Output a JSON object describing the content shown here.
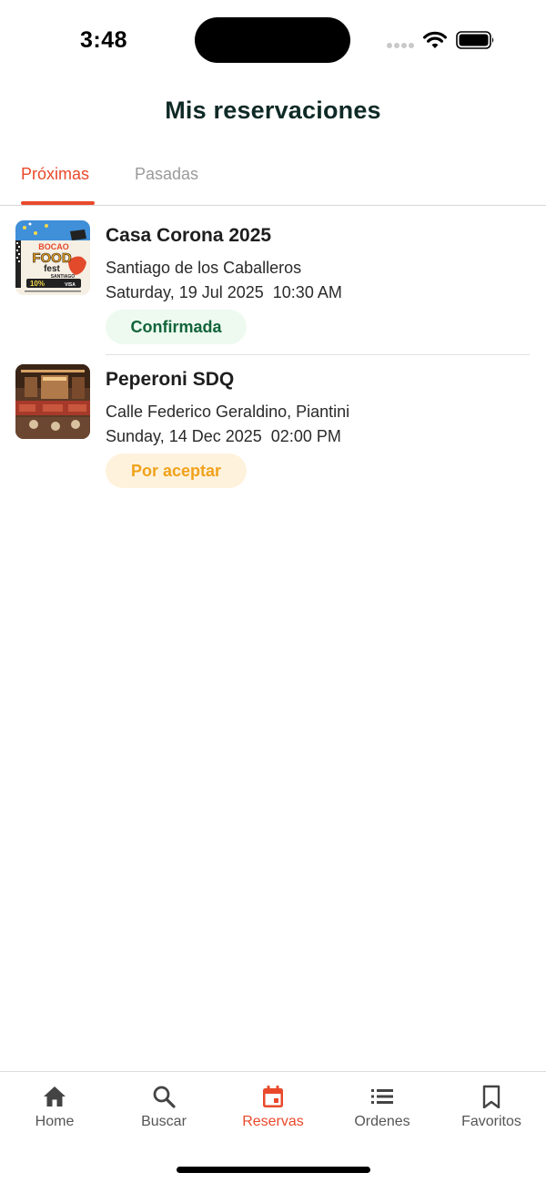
{
  "status_bar": {
    "time": "3:48"
  },
  "header": {
    "title": "Mis reservaciones"
  },
  "tabs": [
    {
      "label": "Próximas",
      "active": true
    },
    {
      "label": "Pasadas",
      "active": false
    }
  ],
  "reservations": [
    {
      "title": "Casa Corona 2025",
      "address": "Santiago de los Caballeros",
      "date": "Saturday, 19 Jul 2025  10:30 AM",
      "status": "Confirmada",
      "image_icon": "bocao-food-fest-poster",
      "poster_text": [
        "BOCAO",
        "FOOD",
        "fest",
        "SANTIAGO",
        "10%",
        "VISA"
      ]
    },
    {
      "title": "Peperoni SDQ",
      "address": "Calle Federico Geraldino, Piantini",
      "date": "Sunday, 14 Dec 2025  02:00 PM",
      "status": "Por aceptar",
      "image_icon": "restaurant-interior-photo"
    }
  ],
  "bottom_nav": [
    {
      "label": "Home",
      "icon": "home-icon",
      "active": false
    },
    {
      "label": "Buscar",
      "icon": "search-icon",
      "active": false
    },
    {
      "label": "Reservas",
      "icon": "calendar-icon",
      "active": true
    },
    {
      "label": "Ordenes",
      "icon": "list-icon",
      "active": false
    },
    {
      "label": "Favoritos",
      "icon": "bookmark-icon",
      "active": false
    }
  ],
  "colors": {
    "accent": "#e9492b",
    "title": "#0f2a26",
    "confirmed_text": "#12643a",
    "confirmed_bg": "#eefaf0",
    "pending_text": "#f0a21b",
    "pending_bg": "#fff2dd"
  }
}
